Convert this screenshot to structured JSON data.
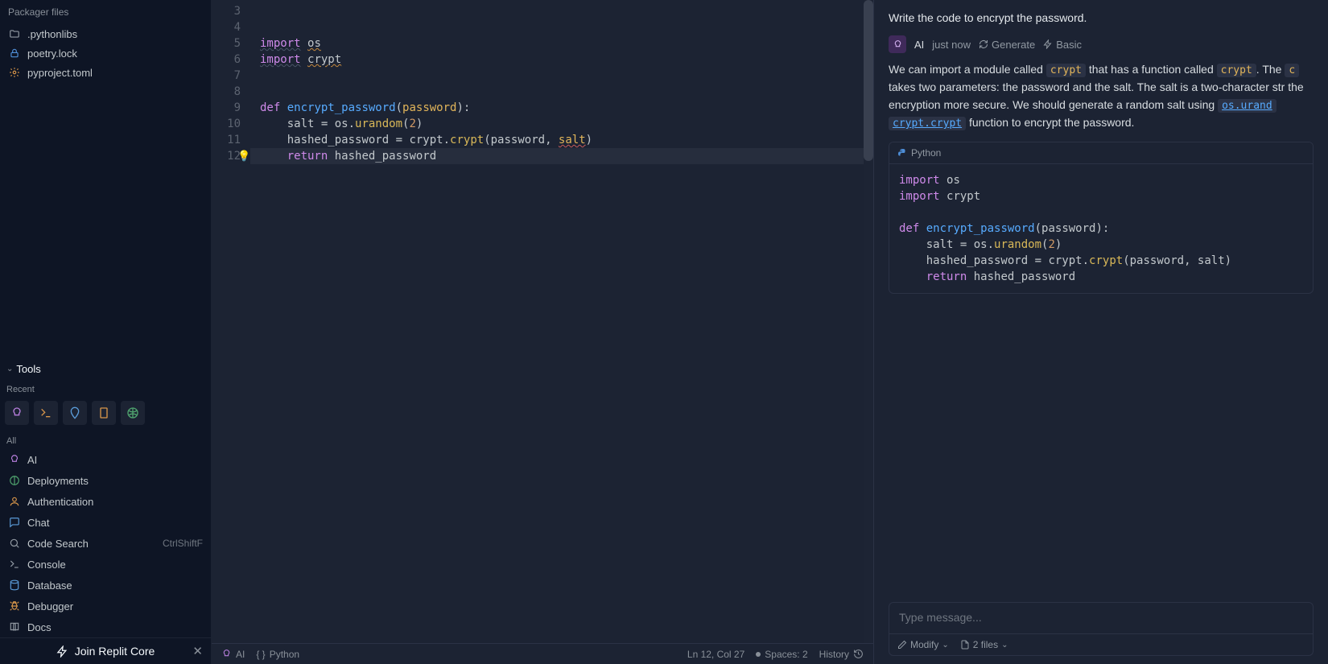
{
  "sidebar": {
    "packager_header": "Packager files",
    "files": [
      {
        "name": ".pythonlibs",
        "icon": "folder"
      },
      {
        "name": "poetry.lock",
        "icon": "lock"
      },
      {
        "name": "pyproject.toml",
        "icon": "gear"
      }
    ],
    "tools_header": "Tools",
    "recent_label": "Recent",
    "all_label": "All",
    "tools": [
      {
        "name": "AI",
        "icon": "ai"
      },
      {
        "name": "Deployments",
        "icon": "deploy"
      },
      {
        "name": "Authentication",
        "icon": "auth"
      },
      {
        "name": "Chat",
        "icon": "chat"
      },
      {
        "name": "Code Search",
        "icon": "search",
        "shortcut": "CtrlShiftF"
      },
      {
        "name": "Console",
        "icon": "console"
      },
      {
        "name": "Database",
        "icon": "db"
      },
      {
        "name": "Debugger",
        "icon": "bug"
      },
      {
        "name": "Docs",
        "icon": "docs"
      }
    ],
    "cta": "Join Replit Core"
  },
  "editor": {
    "line_start": 3,
    "bulb_line": 12,
    "current_line": 12,
    "code": [
      "",
      "",
      "import os",
      "import crypt",
      "",
      "",
      "def encrypt_password(password):",
      "    salt = os.urandom(2)",
      "    hashed_password = crypt.crypt(password, salt)",
      "    return hashed_password"
    ],
    "status": {
      "ai": "AI",
      "lang": "Python",
      "pos": "Ln 12, Col 27",
      "spaces": "Spaces: 2",
      "history": "History"
    }
  },
  "ai": {
    "prompt": "Write the code to encrypt the password.",
    "author": "AI",
    "time": "just now",
    "generate": "Generate",
    "mode": "Basic",
    "response_parts": {
      "p1": "We can import a module called ",
      "c1": "crypt",
      "p2": " that has a function called ",
      "c2": "crypt",
      "p3": ". The ",
      "p4": "takes two parameters: the password and the salt. The salt is a two-character str",
      "p5": "the encryption more secure. We should generate a random salt using ",
      "c3": "os.urand",
      "p6": " function to encrypt the password.",
      "c4": "crypt.crypt"
    },
    "code_lang": "Python",
    "code": "import os\nimport crypt\n\ndef encrypt_password(password):\n    salt = os.urandom(2)\n    hashed_password = crypt.crypt(password, salt)\n    return hashed_password",
    "input_placeholder": "Type message...",
    "toolbar": {
      "modify": "Modify",
      "files": "2 files"
    }
  }
}
